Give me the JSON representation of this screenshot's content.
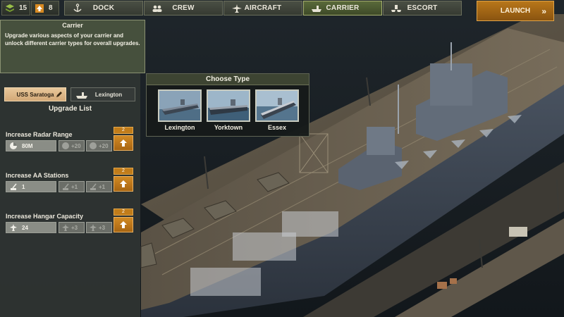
{
  "resources": {
    "supplies": {
      "icon": "layers-icon",
      "value": "15"
    },
    "upgrades": {
      "icon": "upgrade-arrow-icon",
      "value": "8"
    }
  },
  "tabs": [
    {
      "id": "dock",
      "label": "DOCK",
      "icon": "anchor-icon",
      "active": false
    },
    {
      "id": "crew",
      "label": "CREW",
      "icon": "crew-icon",
      "active": false
    },
    {
      "id": "aircraft",
      "label": "AIRCRAFT",
      "icon": "plane-icon",
      "active": false
    },
    {
      "id": "carrier",
      "label": "CARRIER",
      "icon": "carrier-icon",
      "active": true
    },
    {
      "id": "escort",
      "label": "ESCORT",
      "icon": "escort-icon",
      "active": false
    }
  ],
  "launch": {
    "label": "LAUNCH",
    "icon": "double-chevron-right-icon"
  },
  "info": {
    "title": "Carrier",
    "body": "Upgrade various aspects of your carrier and unlock different carrier types for overall upgrades."
  },
  "carriers": {
    "selected": "USS Saratoga",
    "other": "Lexington"
  },
  "upgrade_list": {
    "title": "Upgrade List",
    "items": [
      {
        "name": "Increase Radar Range",
        "icon": "radar-icon",
        "current": "80M",
        "next1": "+20",
        "next2": "+20",
        "level": "2"
      },
      {
        "name": "Increase AA Stations",
        "icon": "aa-gun-icon",
        "current": "1",
        "next1": "+1",
        "next2": "+1",
        "level": "2"
      },
      {
        "name": "Increase Hangar Capacity",
        "icon": "plane-icon",
        "current": "24",
        "next1": "+3",
        "next2": "+3",
        "level": "2"
      }
    ]
  },
  "choose_type": {
    "title": "Choose Type",
    "types": [
      "Lexington",
      "Yorktown",
      "Essex"
    ]
  },
  "colors": {
    "accent_orange": "#c17c1a",
    "panel_green": "#48523e",
    "tab_active": "#5a6a3a"
  }
}
